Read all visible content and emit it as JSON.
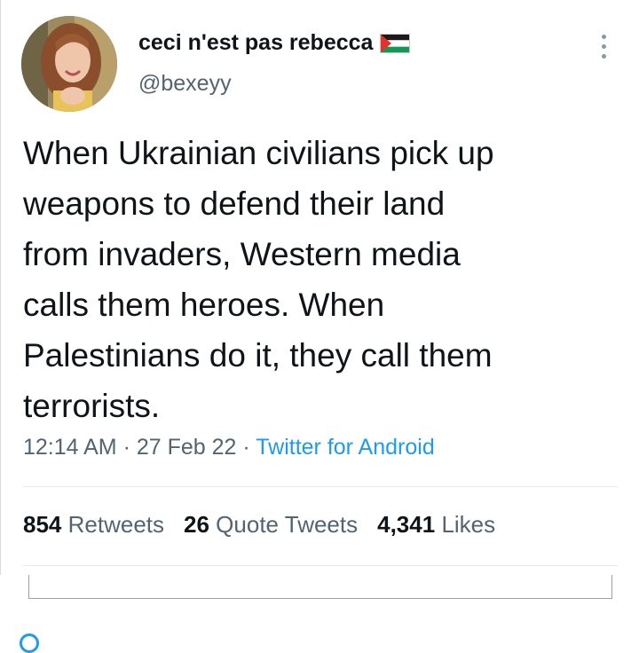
{
  "author": {
    "display_name": "ceci n'est pas rebecca",
    "flag_icon": "palestine-flag-icon",
    "handle": "@bexeyy"
  },
  "tweet": {
    "text": "When Ukrainian civilians pick up\nweapons to defend their land\nfrom invaders, Western media\ncalls them heroes. When\nPalestinians do it, they call them\nterrorists.",
    "time": "12:14 AM",
    "date": "27 Feb 22",
    "separator": "·",
    "source": "Twitter for Android"
  },
  "stats": {
    "retweets_count": "854",
    "retweets_label": "Retweets",
    "quote_count": "26",
    "quote_label": "Quote Tweets",
    "likes_count": "4,341",
    "likes_label": "Likes"
  },
  "colors": {
    "text": "#0f1419",
    "secondary": "#536471",
    "link": "#1d9bf0",
    "divider": "#e6e9ea"
  }
}
